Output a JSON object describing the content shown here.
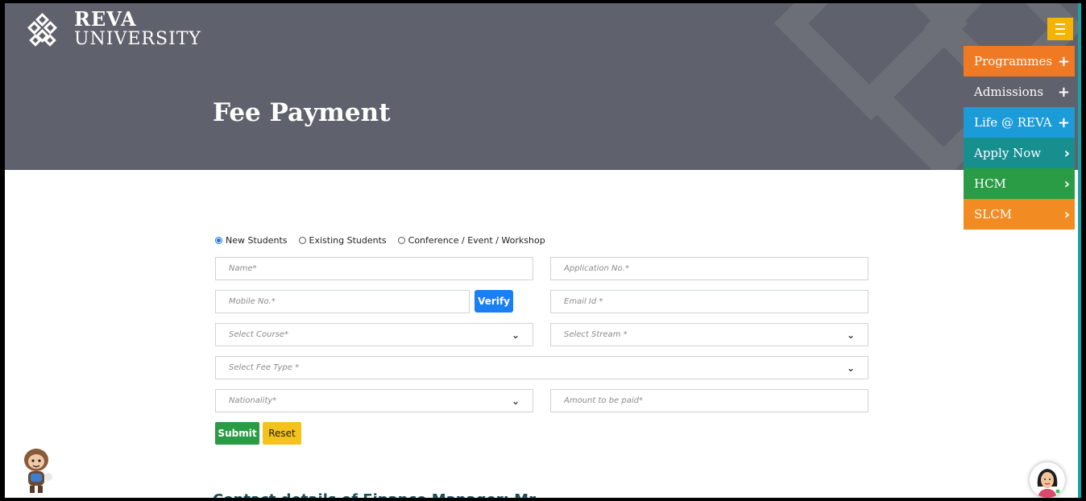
{
  "brand": {
    "name_line1": "REVA",
    "name_line2": "UNIVERSITY"
  },
  "page": {
    "title": "Fee Payment",
    "next_section_heading": "Contact details of Finance Manager: Mr."
  },
  "side_menu": [
    {
      "label": "Programmes",
      "symbol": "+",
      "color": "#f07a23"
    },
    {
      "label": "Admissions",
      "symbol": "+",
      "color": "#5f626c"
    },
    {
      "label": "Life @ REVA",
      "symbol": "+",
      "color": "#1b9bd8"
    },
    {
      "label": "Apply Now",
      "symbol": "›",
      "color": "#178f8f"
    },
    {
      "label": "HCM",
      "symbol": "›",
      "color": "#2a9c45"
    },
    {
      "label": "SLCM",
      "symbol": "›",
      "color": "#f28b22"
    }
  ],
  "form": {
    "student_types": [
      {
        "label": "New Students",
        "selected": true
      },
      {
        "label": "Existing Students",
        "selected": false
      },
      {
        "label": "Conference / Event / Workshop",
        "selected": false
      }
    ],
    "name_placeholder": "Name*",
    "application_no_placeholder": "Application No.*",
    "mobile_placeholder": "Mobile No.*",
    "verify_label": "Verify",
    "email_placeholder": "Email Id *",
    "course_select": "Select Course*",
    "stream_select": "Select Stream *",
    "fee_type_select": "Select Fee Type *",
    "nationality_select": "Nationality*",
    "amount_placeholder": "Amount to be paid*",
    "submit_label": "Submit",
    "reset_label": "Reset"
  },
  "colors": {
    "header_bg": "#5f626c",
    "hamburger": "#f4b400",
    "accent_teal": "#16a3a7"
  }
}
